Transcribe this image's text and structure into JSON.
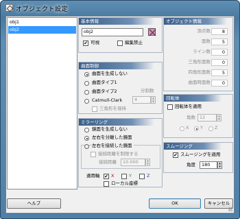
{
  "window": {
    "title": "オブジェクト設定"
  },
  "object_list": {
    "items": [
      "obj1",
      "obj2"
    ],
    "selected_index": 1
  },
  "basic": {
    "header": "基本情報",
    "name_value": "obj2",
    "color": "#e48bc0",
    "visible_label": "可視",
    "visible_checked": true,
    "lock_label": "編集禁止",
    "lock_checked": false
  },
  "surface": {
    "header": "曲面制御",
    "options": [
      "曲面を生成しない",
      "曲面タイプ1",
      "曲面タイプ2",
      "Catmull-Clark"
    ],
    "selected_index": 0,
    "divisions_label": "分割数",
    "divisions_value": "4",
    "keep_triangle_label": "三角形を保持"
  },
  "mirror": {
    "header": "ミラーリング",
    "options": [
      "鏡面を生成しない",
      "左右を分離した鏡面",
      "左右を接続した鏡面"
    ],
    "selected_index": 1,
    "limit_distance_label": "接続距離を制限する",
    "distance_label": "接続距離",
    "distance_value": "10.000",
    "axis_label": "適用軸",
    "axis_x": "X",
    "axis_y": "Y",
    "axis_z": "Z",
    "axis_x_checked": true,
    "local_label": "ローカル座標"
  },
  "info": {
    "header": "オブジェクト情報",
    "rows": [
      {
        "label": "頂点数",
        "value": "8"
      },
      {
        "label": "面数",
        "value": "5"
      },
      {
        "label": "ライン数",
        "value": "0"
      },
      {
        "label": "三角形面数",
        "value": "0"
      },
      {
        "label": "四角形面数",
        "value": "5"
      },
      {
        "label": "曲面時面数",
        "value": "0"
      }
    ]
  },
  "lathe": {
    "header": "回転体",
    "use_label": "回転体を適用",
    "segments_label": "角数",
    "segments_value": "12",
    "axes": [
      "X",
      "Y",
      "Z"
    ],
    "selected_axis": "Y"
  },
  "smoothing": {
    "header": "スムージング",
    "use_label": "スムージングを適用",
    "use_checked": true,
    "angle_label": "角度",
    "angle_value": "180"
  },
  "footer": {
    "help": "ヘルプ",
    "ok": "OK",
    "cancel": "キャンセル"
  }
}
